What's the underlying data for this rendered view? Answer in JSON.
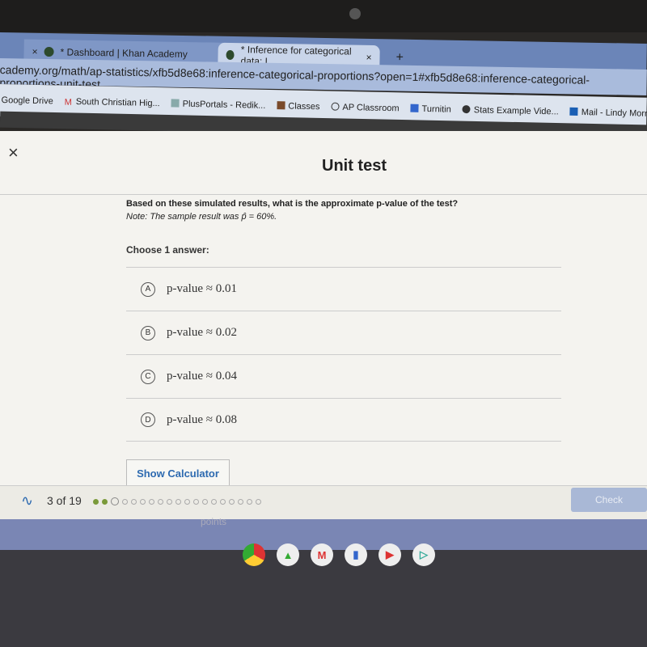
{
  "browser": {
    "tabs": [
      {
        "label": "* Dashboard | Khan Academy"
      },
      {
        "label": "* Inference for categorical data: I"
      }
    ],
    "new_tab": "+",
    "url": "cademy.org/math/ap-statistics/xfb5d8e68:inference-categorical-proportions?open=1#xfb5d8e68:inference-categorical-proportions-unit-test",
    "bookmarks": [
      "Google Drive",
      "South Christian Hig...",
      "PlusPortals - Redik...",
      "Classes",
      "AP Classroom",
      "Turnitin",
      "Stats Example Vide...",
      "Mail - Lindy Morren..."
    ]
  },
  "header": {
    "close": "×",
    "title": "Unit test"
  },
  "question": {
    "text": "Based on these simulated results, what is the approximate p-value of the test?",
    "note": "Note: The sample result was p̂ = 60%.",
    "choose": "Choose 1 answer:"
  },
  "options": [
    {
      "letter": "A",
      "text": "p-value ≈ 0.01"
    },
    {
      "letter": "B",
      "text": "p-value ≈ 0.02"
    },
    {
      "letter": "C",
      "text": "p-value ≈ 0.04"
    },
    {
      "letter": "D",
      "text": "p-value ≈ 0.08"
    }
  ],
  "calculator": "Show Calculator",
  "footer": {
    "progress": "3 of 19",
    "completed": 2,
    "current": 3,
    "total": 19,
    "check": "Check",
    "accent": "#7a9a3a"
  },
  "background_text": "points"
}
